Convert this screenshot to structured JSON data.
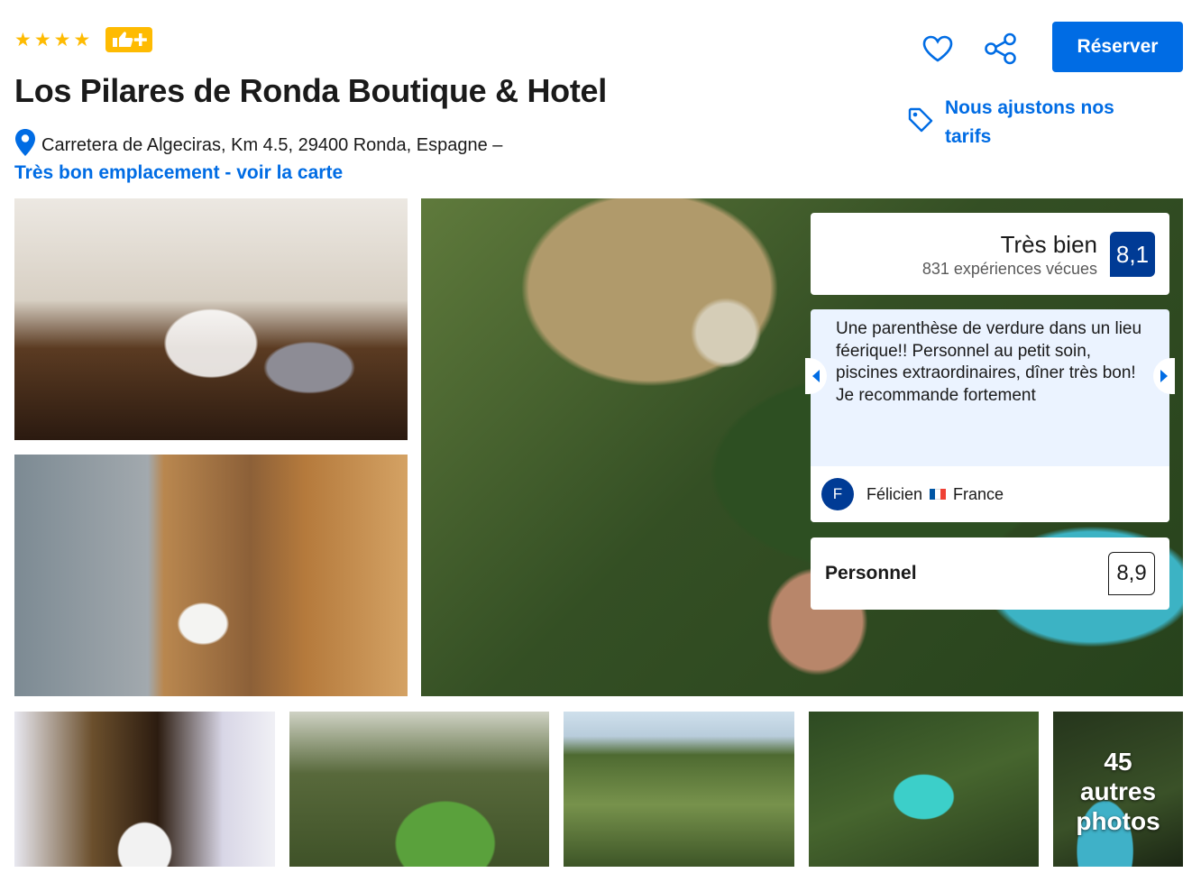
{
  "header": {
    "star_count": 4,
    "star_glyph": "★",
    "thumbs_badge_icon": "thumbs-up-plus-icon",
    "title": "Los Pilares de Ronda Boutique & Hotel",
    "address": "Carretera de Algeciras, Km 4.5, 29400 Ronda, Espagne –",
    "location_link": "Très bon emplacement - voir la carte",
    "reserve_label": "Réserver",
    "price_match": "Nous ajustons nos tarifs",
    "icons": [
      "star-icon",
      "heart-icon",
      "share-icon",
      "tag-icon",
      "map-pin-icon"
    ]
  },
  "rating": {
    "word": "Très bien",
    "count_text": "831 expériences vécues",
    "score": "8,1"
  },
  "review": {
    "text": "Une parenthèse de verdure dans un lieu féerique!! Personnel au petit soin, piscines extraordinaires, dîner très bon! Je recommande fortement",
    "avatar_initial": "F",
    "author": "Félicien",
    "country": "France"
  },
  "staff": {
    "label": "Personnel",
    "score": "8,9"
  },
  "gallery": {
    "more_count": "45",
    "more_line1": "autres",
    "more_line2": "photos"
  },
  "colors": {
    "brand_blue": "#006ce4",
    "score_navy": "#003b95",
    "star_yellow": "#febb02",
    "review_bg": "#ebf3ff"
  }
}
